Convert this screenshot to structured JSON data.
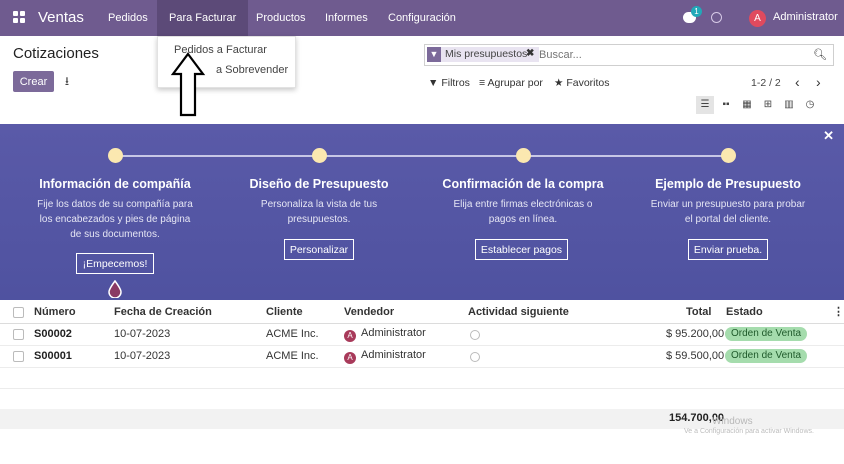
{
  "navbar": {
    "brand": "Ventas",
    "menus": [
      "Pedidos",
      "Para Facturar",
      "Productos",
      "Informes",
      "Configuración"
    ],
    "chat_badge": "1",
    "user_initial": "A",
    "user_name": "Administrator"
  },
  "dropdown": {
    "items": [
      "Pedidos a Facturar",
      "a Sobrevender"
    ]
  },
  "control_panel": {
    "title": "Cotizaciones",
    "create_label": "Crear",
    "facet_label": "Mis presupuestos",
    "search_placeholder": "Buscar...",
    "filters_label": "Filtros",
    "group_label": "Agrupar por",
    "favorites_label": "Favoritos",
    "pager": "1-2 / 2"
  },
  "banner": {
    "steps": [
      {
        "title": "Información de compañía",
        "desc": [
          "Fije los datos de su compañía para",
          "los encabezados y pies de página",
          "de sus documentos."
        ],
        "button": "¡Empecemos!"
      },
      {
        "title": "Diseño de Presupuesto",
        "desc": [
          "Personaliza la vista de tus",
          "presupuestos."
        ],
        "button": "Personalizar"
      },
      {
        "title": "Confirmación de la compra",
        "desc": [
          "Elija entre firmas electrónicas o",
          "pagos en línea."
        ],
        "button": "Establecer pagos"
      },
      {
        "title": "Ejemplo de Presupuesto",
        "desc": [
          "Enviar un presupuesto para probar",
          "el portal del cliente."
        ],
        "button": "Enviar prueba."
      }
    ]
  },
  "table": {
    "columns": [
      "Número",
      "Fecha de Creación",
      "Cliente",
      "Vendedor",
      "Actividad siguiente",
      "Total",
      "Estado"
    ],
    "rows": [
      {
        "number": "S00002",
        "date": "10-07-2023",
        "customer": "ACME Inc.",
        "salesperson": "Administrator",
        "salesperson_initial": "A",
        "total": "$ 95.200,00",
        "status": "Orden de Venta"
      },
      {
        "number": "S00001",
        "date": "10-07-2023",
        "customer": "ACME Inc.",
        "salesperson": "Administrator",
        "salesperson_initial": "A",
        "total": "$ 59.500,00",
        "status": "Orden de Venta"
      }
    ],
    "grand_total": "154.700,00"
  },
  "watermark": {
    "line1": "Windows",
    "line2": "Ve a Configuración para activar Windows."
  },
  "colors": {
    "navbar": "#6f5b8f",
    "primary_button": "#7c6a9a",
    "banner": "#5556a5",
    "status_badge": "#a5dcad"
  }
}
